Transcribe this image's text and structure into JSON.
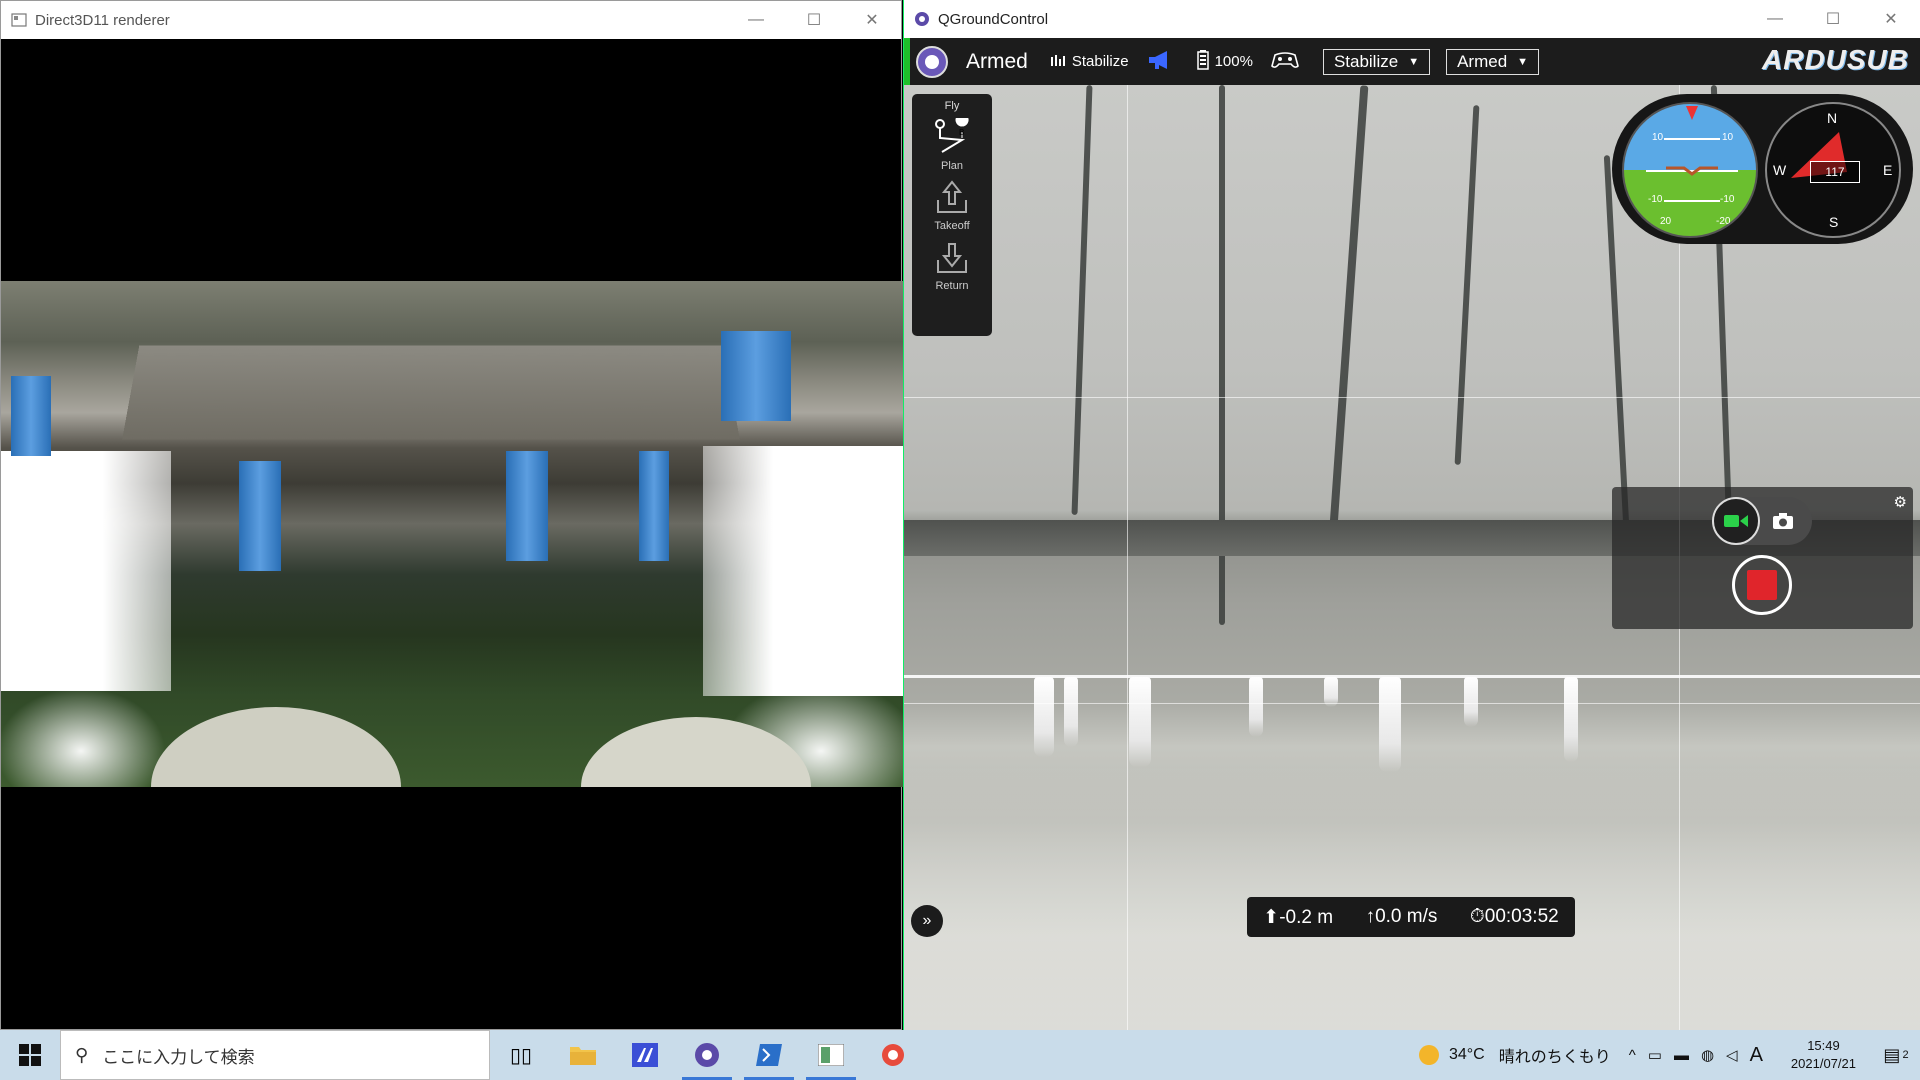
{
  "left_window": {
    "title": "Direct3D11 renderer",
    "controls": {
      "minimize": "—",
      "maximize": "☐",
      "close": "✕"
    }
  },
  "qgc_window": {
    "title": "QGroundControl",
    "controls": {
      "minimize": "—",
      "maximize": "☐",
      "close": "✕"
    },
    "toolbar": {
      "armed_status": "Armed",
      "mode_indicator": "Stabilize",
      "battery": "100%",
      "flight_mode_dropdown": "Stabilize",
      "arm_dropdown": "Armed",
      "brand": "ARDUSUB"
    },
    "toolstrip": {
      "header": "Fly",
      "items": [
        {
          "label": "Plan"
        },
        {
          "label": "Takeoff"
        },
        {
          "label": "Return"
        }
      ]
    },
    "attitude": {
      "pitch_labels": [
        "10",
        "10",
        "-10",
        "-10",
        "20",
        "-20"
      ]
    },
    "compass": {
      "n": "N",
      "e": "E",
      "s": "S",
      "w": "W",
      "heading": "117"
    },
    "telemetry": {
      "depth": "-0.2 m",
      "climb_rate": "0.0 m/s",
      "flight_time": "00:03:52"
    },
    "colors": {
      "armed_green": "#1fbf2a",
      "record_red": "#e0252b",
      "video_green": "#2bd14a"
    }
  },
  "taskbar": {
    "search_placeholder": "ここに入力して検索",
    "weather_temp": "34°C",
    "weather_desc": "晴れのちくもり",
    "time": "15:49",
    "date": "2021/07/21",
    "ime": "A",
    "notification_count": "2"
  }
}
